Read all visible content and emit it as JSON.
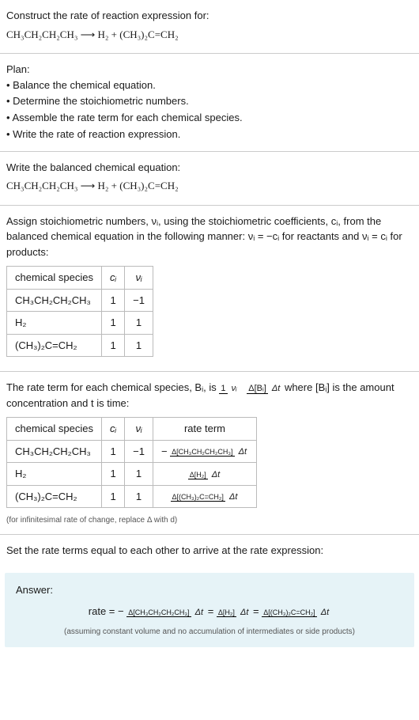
{
  "intro": {
    "title": "Construct the rate of reaction expression for:",
    "equation": "CH₃CH₂CH₂CH₃  ⟶  H₂ + (CH₃)₂C=CH₂"
  },
  "plan": {
    "title": "Plan:",
    "b1": "• Balance the chemical equation.",
    "b2": "• Determine the stoichiometric numbers.",
    "b3": "• Assemble the rate term for each chemical species.",
    "b4": "• Write the rate of reaction expression."
  },
  "balanced": {
    "title": "Write the balanced chemical equation:",
    "equation": "CH₃CH₂CH₂CH₃  ⟶  H₂ + (CH₃)₂C=CH₂"
  },
  "stoich": {
    "intro": "Assign stoichiometric numbers, νᵢ, using the stoichiometric coefficients, cᵢ, from the balanced chemical equation in the following manner: νᵢ = −cᵢ for reactants and νᵢ = cᵢ for products:",
    "h1": "chemical species",
    "h2": "cᵢ",
    "h3": "νᵢ",
    "r1c1": "CH₃CH₂CH₂CH₃",
    "r1c2": "1",
    "r1c3": "−1",
    "r2c1": "H₂",
    "r2c2": "1",
    "r2c3": "1",
    "r3c1": "(CH₃)₂C=CH₂",
    "r3c2": "1",
    "r3c3": "1"
  },
  "rateterm": {
    "pre": "The rate term for each chemical species, Bᵢ, is ",
    "post": " where [Bᵢ] is the amount concentration and t is time:",
    "f1top": "1",
    "f1bot": "νᵢ",
    "f2top": "Δ[Bᵢ]",
    "f2bot": "Δt",
    "h1": "chemical species",
    "h2": "cᵢ",
    "h3": "νᵢ",
    "h4": "rate term",
    "r1c1": "CH₃CH₂CH₂CH₃",
    "r1c2": "1",
    "r1c3": "−1",
    "r1c4top": "Δ[CH₃CH₂CH₂CH₃]",
    "r1c4bot": "Δt",
    "r1c4pre": "−",
    "r2c1": "H₂",
    "r2c2": "1",
    "r2c3": "1",
    "r2c4top": "Δ[H₂]",
    "r2c4bot": "Δt",
    "r3c1": "(CH₃)₂C=CH₂",
    "r3c2": "1",
    "r3c3": "1",
    "r3c4top": "Δ[(CH₃)₂C=CH₂]",
    "r3c4bot": "Δt",
    "note": "(for infinitesimal rate of change, replace Δ with d)"
  },
  "final": {
    "title": "Set the rate terms equal to each other to arrive at the rate expression:"
  },
  "answer": {
    "title": "Answer:",
    "pre": "rate = −",
    "f1top": "Δ[CH₃CH₂CH₂CH₃]",
    "f1bot": "Δt",
    "eq1": " = ",
    "f2top": "Δ[H₂]",
    "f2bot": "Δt",
    "eq2": " = ",
    "f3top": "Δ[(CH₃)₂C=CH₂]",
    "f3bot": "Δt",
    "note": "(assuming constant volume and no accumulation of intermediates or side products)"
  }
}
